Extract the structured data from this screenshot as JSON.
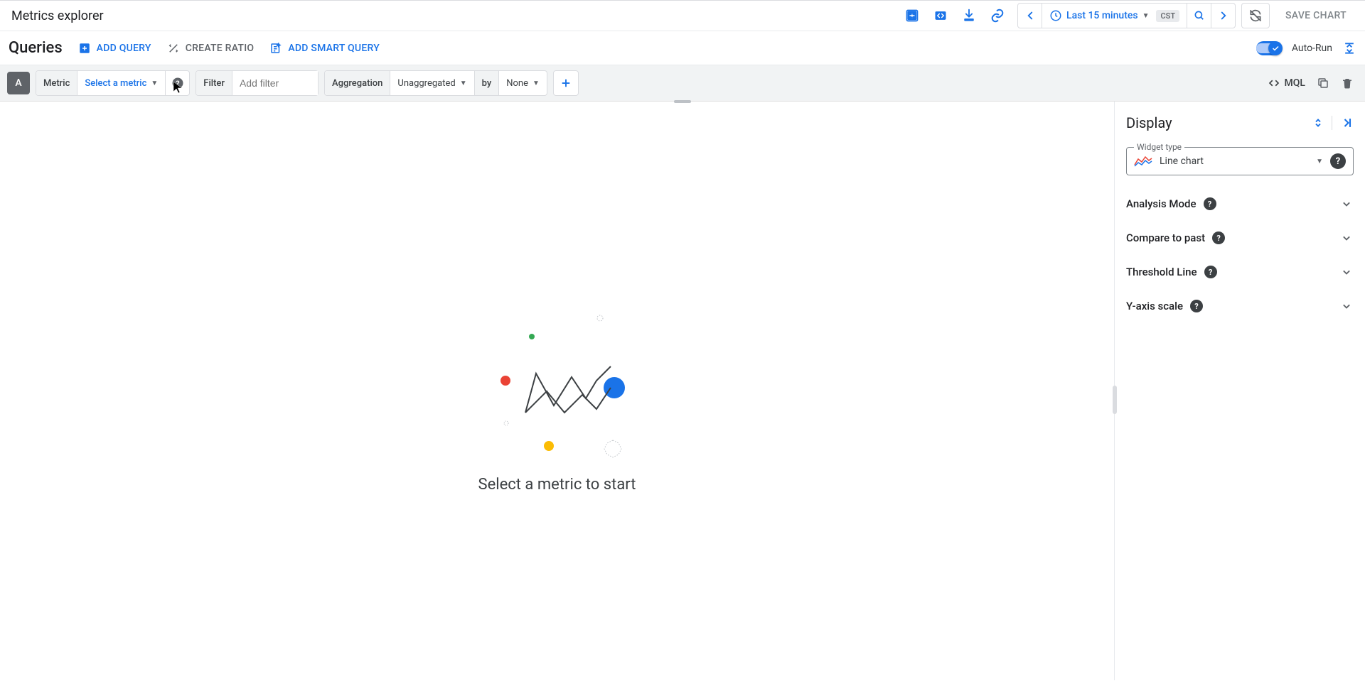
{
  "header": {
    "title": "Metrics explorer",
    "time_range": "Last 15 minutes",
    "timezone": "CST",
    "save_chart": "SAVE CHART"
  },
  "queries_bar": {
    "title": "Queries",
    "add_query": "ADD QUERY",
    "create_ratio": "CREATE RATIO",
    "add_smart_query": "ADD SMART QUERY",
    "autorun": "Auto-Run"
  },
  "query_row": {
    "badge": "A",
    "metric_label": "Metric",
    "metric_value": "Select a metric",
    "filter_label": "Filter",
    "filter_placeholder": "Add filter",
    "aggregation_label": "Aggregation",
    "aggregation_value": "Unaggregated",
    "by_label": "by",
    "by_value": "None",
    "mql": "MQL"
  },
  "empty_state": {
    "message": "Select a metric to start"
  },
  "side_panel": {
    "title": "Display",
    "widget_type_label": "Widget type",
    "widget_type_value": "Line chart",
    "sections": [
      {
        "label": "Analysis Mode"
      },
      {
        "label": "Compare to past"
      },
      {
        "label": "Threshold Line"
      },
      {
        "label": "Y-axis scale"
      }
    ]
  }
}
